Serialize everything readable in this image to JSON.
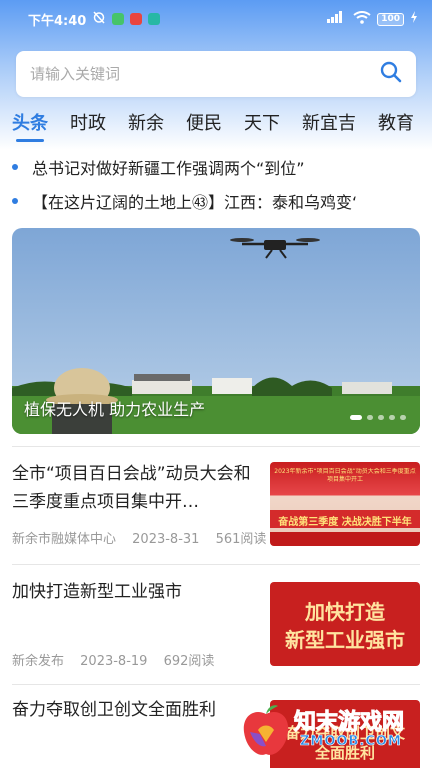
{
  "status": {
    "time": "下午4:40",
    "battery": "100"
  },
  "search": {
    "placeholder": "请输入关键词"
  },
  "tabs": [
    {
      "label": "头条"
    },
    {
      "label": "时政"
    },
    {
      "label": "新余"
    },
    {
      "label": "便民"
    },
    {
      "label": "天下"
    },
    {
      "label": "新宜吉"
    },
    {
      "label": "教育"
    }
  ],
  "headlines": [
    {
      "text": "总书记对做好新疆工作强调两个“到位”"
    },
    {
      "text": "【在这片辽阔的土地上㊸】江西：泰和乌鸡变‘"
    }
  ],
  "banner": {
    "caption": "植保无人机 助力农业生产"
  },
  "news": [
    {
      "title": "全市“项目百日会战”动员大会和三季度重点项目集中开…",
      "source": "新余市融媒体中心",
      "date": "2023-8-31",
      "reads": "561阅读",
      "thumb_line1": "2023年新余市“项目百日会战”动员大会和三季度重点项目集中开工",
      "thumb_line2": "奋战第三季度 决战决胜下半年"
    },
    {
      "title": "加快打造新型工业强市",
      "source": "新余发布",
      "date": "2023-8-19",
      "reads": "692阅读",
      "thumb_line1": "加快打造",
      "thumb_line2": "新型工业强市"
    },
    {
      "title": "奋力夺取创卫创文全面胜利",
      "thumb_line1": "奋力夺取创卫创文",
      "thumb_line2": "全面胜利"
    }
  ],
  "watermark": {
    "name": "知末游戏网",
    "url": "ZMOOB.COM"
  },
  "colors": {
    "accent": "#2f7de1",
    "header_top": "#5c9cf3"
  }
}
